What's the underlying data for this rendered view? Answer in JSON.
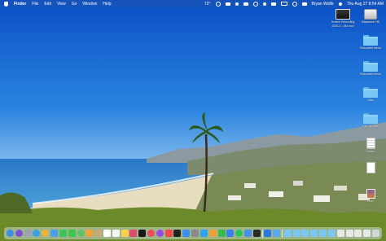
{
  "menubar": {
    "app_name": "Finder",
    "menus": [
      "File",
      "Edit",
      "View",
      "Go",
      "Window",
      "Help"
    ],
    "temperature": "72°",
    "user": "Bryan Wolfe",
    "datetime": "Thu Aug 27  8:54 AM"
  },
  "desktop": {
    "items": [
      {
        "label": "Screen Recording",
        "label2": "2020-0...AM.mov",
        "icon": "video-thumbnail-icon"
      },
      {
        "label": "Macintosh HD",
        "icon": "hard-drive-icon"
      },
      {
        "label": "Relocated Items",
        "icon": "folder-icon"
      },
      {
        "label": "Relocated Items",
        "icon": "folder-icon"
      },
      {
        "label": "Jobs",
        "icon": "folder-icon"
      },
      {
        "label": "iOS 14 Beta",
        "icon": "folder-icon"
      },
      {
        "label": "Notes",
        "icon": "document-icon"
      },
      {
        "label": "",
        "icon": "document-icon"
      },
      {
        "label": "Mom",
        "icon": "image-icon"
      }
    ]
  },
  "dock": {
    "items": [
      {
        "name": "finder",
        "color": "#3b8fe6"
      },
      {
        "name": "siri",
        "color": "#7a4fd0"
      },
      {
        "name": "launchpad",
        "color": "#9aa4b0"
      },
      {
        "name": "safari",
        "color": "#3aa0e8"
      },
      {
        "name": "chrome",
        "color": "#e8b43a"
      },
      {
        "name": "mail",
        "color": "#4a9ef0"
      },
      {
        "name": "facetime",
        "color": "#3cc45a"
      },
      {
        "name": "messages",
        "color": "#38c84e"
      },
      {
        "name": "maps",
        "color": "#5fbf6a"
      },
      {
        "name": "photos",
        "color": "#f0a33a"
      },
      {
        "name": "contacts",
        "color": "#c8a87a"
      },
      {
        "name": "calendar",
        "color": "#ffffff"
      },
      {
        "name": "reminders",
        "color": "#f4f4f4"
      },
      {
        "name": "notes",
        "color": "#f5d24a"
      },
      {
        "name": "slack",
        "color": "#e04a6a"
      },
      {
        "name": "tv",
        "color": "#1a1a1a"
      },
      {
        "name": "music",
        "color": "#f04a5a"
      },
      {
        "name": "podcasts",
        "color": "#9a4ae0"
      },
      {
        "name": "news",
        "color": "#f04a4a"
      },
      {
        "name": "stocks",
        "color": "#222222"
      },
      {
        "name": "app-store",
        "color": "#3a8ef0"
      },
      {
        "name": "system-preferences",
        "color": "#8a8a8a"
      },
      {
        "name": "twitter",
        "color": "#2aa4f0"
      },
      {
        "name": "pages",
        "color": "#f0a03a"
      },
      {
        "name": "numbers",
        "color": "#3ab84a"
      },
      {
        "name": "keynote",
        "color": "#3a7ef0"
      },
      {
        "name": "spotify",
        "color": "#2ac45a"
      },
      {
        "name": "xcode",
        "color": "#4a8ef0"
      },
      {
        "name": "terminal",
        "color": "#2a2a2a"
      },
      {
        "name": "sep",
        "color": ""
      },
      {
        "name": "dropbox",
        "color": "#2a78e6"
      },
      {
        "name": "downloads",
        "color": "#5aa8e8"
      },
      {
        "name": "sep",
        "color": ""
      },
      {
        "name": "folder-1",
        "color": "#7ac6f5"
      },
      {
        "name": "folder-2",
        "color": "#7ac6f5"
      },
      {
        "name": "folder-3",
        "color": "#7ac6f5"
      },
      {
        "name": "folder-4",
        "color": "#7ac6f5"
      },
      {
        "name": "folder-5",
        "color": "#7ac6f5"
      },
      {
        "name": "folder-6",
        "color": "#7ac6f5"
      },
      {
        "name": "doc-1",
        "color": "#e8e8e8"
      },
      {
        "name": "doc-2",
        "color": "#e8e8e8"
      },
      {
        "name": "doc-3",
        "color": "#e8e8e8"
      },
      {
        "name": "doc-4",
        "color": "#e8e8e8"
      },
      {
        "name": "trash",
        "color": "#cfd6dc"
      }
    ]
  }
}
